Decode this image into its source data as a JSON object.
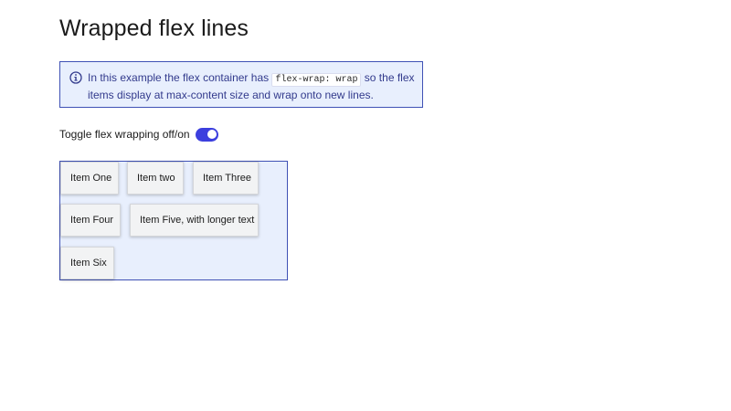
{
  "page": {
    "title": "Wrapped flex lines"
  },
  "info": {
    "icon": "info-icon",
    "text_before": "In this example the flex container has ",
    "code": "flex-wrap: wrap",
    "text_after": " so the flex items display at max-content size and wrap onto new lines."
  },
  "toggle": {
    "label": "Toggle flex wrapping off/on",
    "state": "on",
    "accent_color": "#3c3fde"
  },
  "flex_items": [
    "Item One",
    "Item two",
    "Item Three",
    "Item Four",
    "Item Five, with longer text",
    "Item Six"
  ],
  "colors": {
    "container_background": "#e8effd",
    "container_border": "#3f51b5",
    "item_background": "#f2f3f4"
  }
}
